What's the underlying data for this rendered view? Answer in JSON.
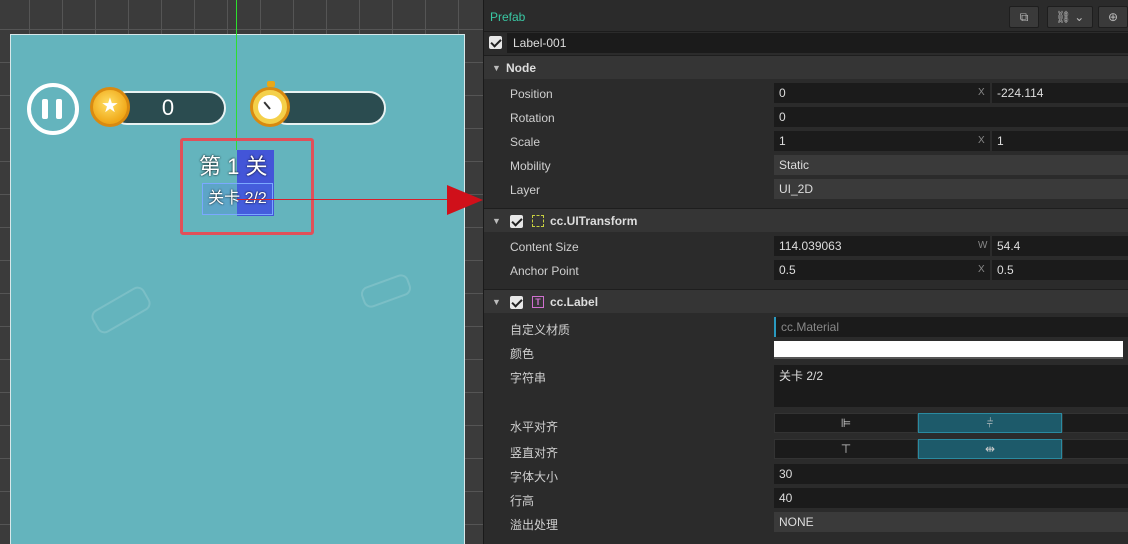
{
  "scene": {
    "coin_count": "0",
    "level_title": "第 1 关",
    "label_text": "关卡 2/2"
  },
  "inspector": {
    "header_title": "Prefab",
    "node_name": "Label-001",
    "node_section": "Node",
    "position_label": "Position",
    "position_x": "0",
    "position_y": "-224.114",
    "rotation_label": "Rotation",
    "rotation_value": "0",
    "scale_label": "Scale",
    "scale_x": "1",
    "scale_y": "1",
    "mobility_label": "Mobility",
    "mobility_value": "Static",
    "layer_label": "Layer",
    "layer_value": "UI_2D",
    "transform_section": "cc.UITransform",
    "content_size_label": "Content Size",
    "content_w": "114.039063",
    "content_h": "54.4",
    "anchor_label": "Anchor Point",
    "anchor_x": "0.5",
    "anchor_y": "0.5",
    "label_section": "cc.Label",
    "material_label": "自定义材质",
    "material_value": "cc.Material",
    "color_label": "颜色",
    "color_value": "#ffffff",
    "string_label": "字符串",
    "string_value": "关卡 2/2",
    "halign_label": "水平对齐",
    "valign_label": "竖直对齐",
    "font_size_label": "字体大小",
    "font_size_value": "30",
    "line_height_label": "行高",
    "line_height_value": "40",
    "overflow_label": "溢出处理",
    "overflow_value": "NONE",
    "axis_x": "X",
    "axis_w": "W"
  },
  "icons": [
    "pause-icon",
    "star-coin-icon",
    "stopwatch-icon",
    "edit-icon",
    "link-icon",
    "target-icon",
    "transform-icon",
    "text-icon",
    "align-left-icon",
    "align-center-icon",
    "align-top-icon",
    "align-middle-icon"
  ]
}
